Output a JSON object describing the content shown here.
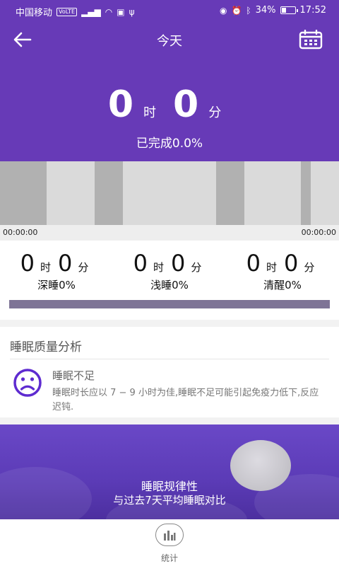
{
  "status_bar": {
    "carrier": "中国移动",
    "network_badge": "VoLTE",
    "battery": "34%",
    "battery_level": 0.34,
    "time": "17:52"
  },
  "header": {
    "title": "今天",
    "hours": "0",
    "hour_unit": "时",
    "minutes": "0",
    "minute_unit": "分",
    "completion": "已完成0.0%"
  },
  "chart": {
    "start_time": "00:00:00",
    "end_time": "00:00:00",
    "colors": {
      "light": "#dadada",
      "dark": "#b1b1b1"
    }
  },
  "stats": [
    {
      "hours": "0",
      "hour_unit": "时",
      "minutes": "0",
      "minute_unit": "分",
      "label": "深睡0%"
    },
    {
      "hours": "0",
      "hour_unit": "时",
      "minutes": "0",
      "minute_unit": "分",
      "label": "浅睡0%"
    },
    {
      "hours": "0",
      "hour_unit": "时",
      "minutes": "0",
      "minute_unit": "分",
      "label": "清醒0%"
    }
  ],
  "quality": {
    "title": "睡眠质量分析",
    "heading": "睡眠不足",
    "description": "睡眠时长应以 7 − 9 小时为佳,睡眠不足可能引起免疫力低下,反应迟钝."
  },
  "banner": {
    "title": "睡眠规律性",
    "subtitle": "与过去7天平均睡眠对比"
  },
  "nav": {
    "stats_label": "统计"
  },
  "colors": {
    "primary": "#673ab7",
    "accent_icon": "#5e2bd0",
    "ratio_bar": "#7e7496"
  }
}
